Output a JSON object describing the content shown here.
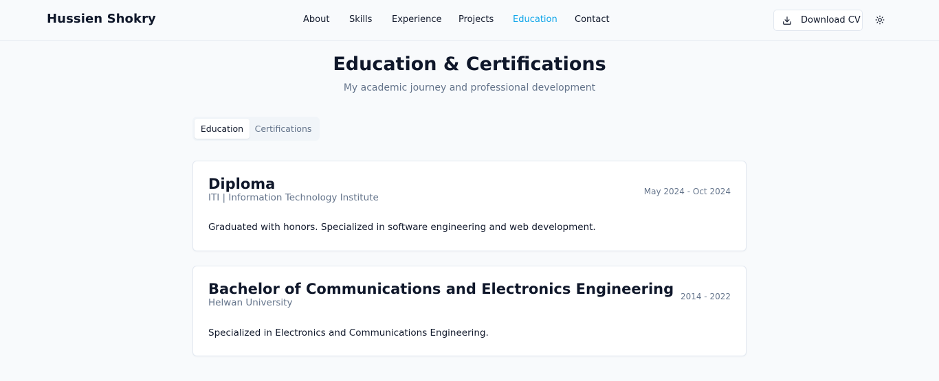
{
  "brand": "Hussien Shokry",
  "nav": {
    "links": [
      "About",
      "Skills",
      "Experience",
      "Projects",
      "Education",
      "Contact"
    ],
    "active": "Education",
    "download_label": "Download CV",
    "download_icon": "download-icon",
    "theme_icon": "sun-icon"
  },
  "section": {
    "title": "Education & Certifications",
    "subtitle": "My academic journey and professional development"
  },
  "tabs": [
    {
      "label": "Education",
      "active": true
    },
    {
      "label": "Certifications",
      "active": false
    }
  ],
  "education": [
    {
      "title": "Diploma",
      "institution": "ITI | Information Technology Institute",
      "dates": "May 2024 - Oct 2024",
      "description": "Graduated with honors. Specialized in software engineering and web development."
    },
    {
      "title": "Bachelor of Communications and Electronics Engineering",
      "institution": "Helwan University",
      "dates": "2014 - 2022",
      "description": "Specialized in Electronics and Communications Engineering."
    }
  ],
  "colors": {
    "accent": "#0ea5e9",
    "text": "#0f172a",
    "muted": "#64748b",
    "background": "#f8fafc",
    "border": "#e2e8f0"
  }
}
